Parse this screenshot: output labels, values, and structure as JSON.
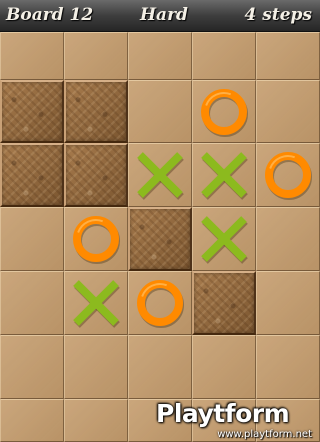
{
  "header": {
    "board": "Board 12",
    "difficulty": "Hard",
    "steps": "4 steps"
  },
  "board": {
    "rows": 7,
    "cols": 5,
    "cells": [
      [
        "open",
        "open",
        "open",
        "open",
        "open"
      ],
      [
        "block",
        "block",
        "open",
        "O",
        "open"
      ],
      [
        "block",
        "block",
        "X",
        "X",
        "O"
      ],
      [
        "open",
        "O",
        "block",
        "X",
        "open"
      ],
      [
        "open",
        "X",
        "O",
        "block",
        "open"
      ],
      [
        "open",
        "open",
        "open",
        "open",
        "open"
      ],
      [
        "open",
        "open",
        "open",
        "open",
        "open"
      ]
    ]
  },
  "colors": {
    "x_piece": "#8cba1e",
    "o_piece": "#ff8a00",
    "wood_light": "#c49c6d",
    "wood_dark": "#7b5630"
  },
  "watermark": {
    "logo": "Playtform",
    "url": "www.playtform.net"
  }
}
